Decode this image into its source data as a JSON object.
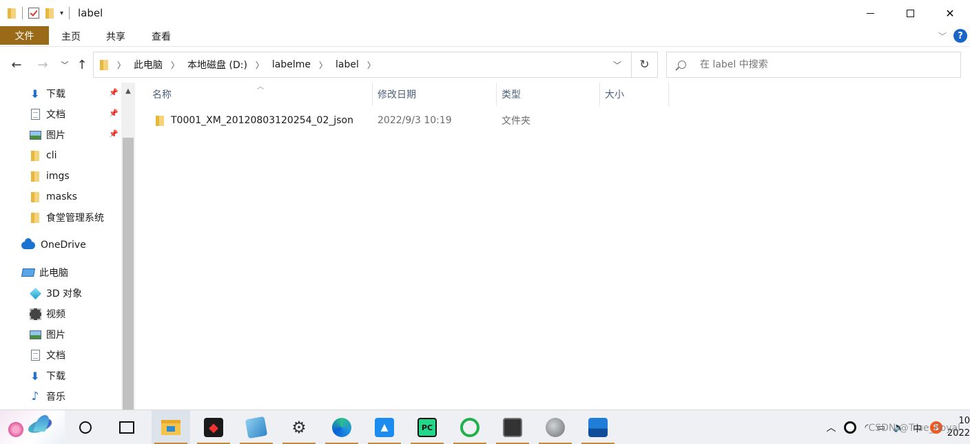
{
  "window": {
    "title": "label",
    "controls": {
      "minimize": "minimize",
      "maximize": "maximize",
      "close": "✕"
    }
  },
  "ribbon": {
    "tabs": [
      "文件",
      "主页",
      "共享",
      "查看"
    ]
  },
  "address": {
    "crumbs": [
      "此电脑",
      "本地磁盘 (D:)",
      "labelme",
      "label"
    ]
  },
  "search": {
    "placeholder": "在 label 中搜索"
  },
  "sidebar": {
    "items": [
      {
        "label": "下载",
        "icon": "download-icon",
        "pinned": true
      },
      {
        "label": "文档",
        "icon": "document-icon",
        "pinned": true
      },
      {
        "label": "图片",
        "icon": "pictures-icon",
        "pinned": true
      },
      {
        "label": "cli",
        "icon": "folder-icon"
      },
      {
        "label": "imgs",
        "icon": "folder-icon"
      },
      {
        "label": "masks",
        "icon": "folder-icon"
      },
      {
        "label": "食堂管理系统",
        "icon": "folder-icon"
      },
      {
        "label": "OneDrive",
        "icon": "onedrive-icon"
      },
      {
        "label": "此电脑",
        "icon": "this-pc-icon"
      },
      {
        "label": "3D 对象",
        "icon": "3d-objects-icon"
      },
      {
        "label": "视频",
        "icon": "videos-icon"
      },
      {
        "label": "图片",
        "icon": "pictures-icon"
      },
      {
        "label": "文档",
        "icon": "document-icon"
      },
      {
        "label": "下载",
        "icon": "download-icon"
      },
      {
        "label": "音乐",
        "icon": "music-icon"
      }
    ]
  },
  "columns": [
    "名称",
    "修改日期",
    "类型",
    "大小"
  ],
  "files": [
    {
      "name": "T0001_XM_20120803120254_02_json",
      "modified": "2022/9/3 10:19",
      "type": "文件夹",
      "size": ""
    }
  ],
  "taskbar": {
    "apps": [
      "cortana",
      "task-view",
      "file-explorer",
      "red-app",
      "notepad",
      "settings",
      "edge",
      "blue-app",
      "pycharm",
      "ring-app",
      "terminal",
      "avatar-app",
      "photos"
    ],
    "tray": {
      "ime": "中",
      "clock_line1": "10",
      "clock_line2": "2022"
    },
    "watermark": "CSDN @True_Royal"
  },
  "colors": {
    "file_tab": "#9a6a19",
    "accent": "#1a66c7",
    "taskbar_indicator": "#c58a3a"
  }
}
